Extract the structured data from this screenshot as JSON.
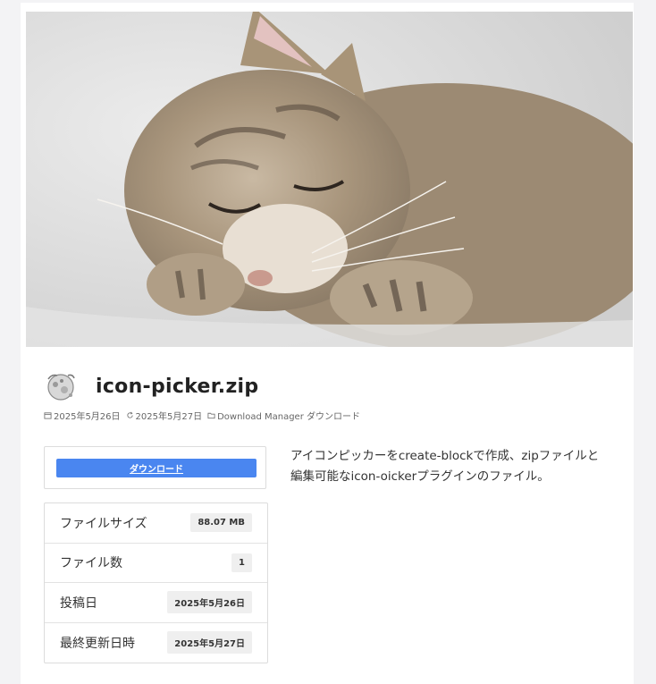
{
  "hero": {
    "image_label": "sleeping-kitten-photo"
  },
  "post": {
    "title": "icon-picker.zip",
    "published": "2025年5月26日",
    "updated": "2025年5月27日",
    "category": "Download Manager ダウンロード"
  },
  "download": {
    "button_label": "ダウンロード"
  },
  "info": {
    "rows": [
      {
        "label": "ファイルサイズ",
        "value": "88.07 MB"
      },
      {
        "label": "ファイル数",
        "value": "1"
      },
      {
        "label": "投稿日",
        "value": "2025年5月26日"
      },
      {
        "label": "最終更新日時",
        "value": "2025年5月27日"
      }
    ]
  },
  "description": {
    "line1": "アイコンピッカーをcreate-blockで作成、zipファイルと",
    "line2": "編集可能なicon-oickerプラグインのファイル。"
  },
  "colors": {
    "button": "#4a86f0",
    "badge_bg": "#efefef",
    "border": "#dcdcdc"
  }
}
